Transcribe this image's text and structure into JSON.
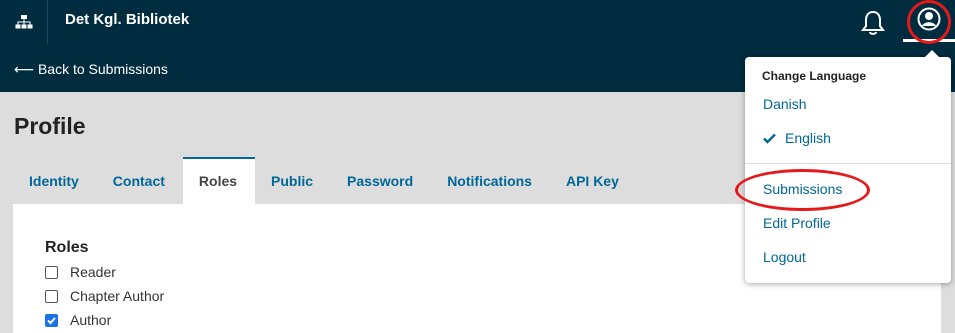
{
  "header": {
    "site_name": "Det Kgl. Bibliotek",
    "site_icon": "sitemap-icon",
    "notifications_icon": "bell-icon",
    "user_icon": "user-circle-icon"
  },
  "subheader": {
    "back_link": "⟵ Back to Submissions"
  },
  "main": {
    "title": "Profile",
    "tabs": [
      {
        "label": "Identity"
      },
      {
        "label": "Contact"
      },
      {
        "label": "Roles"
      },
      {
        "label": "Public"
      },
      {
        "label": "Password"
      },
      {
        "label": "Notifications"
      },
      {
        "label": "API Key"
      }
    ],
    "active_tab": "Roles",
    "roles_title": "Roles",
    "roles": [
      {
        "label": "Reader",
        "checked": false
      },
      {
        "label": "Chapter Author",
        "checked": false
      },
      {
        "label": "Author",
        "checked": true
      }
    ]
  },
  "user_menu": {
    "language_heading": "Change Language",
    "languages": [
      {
        "label": "Danish",
        "selected": false
      },
      {
        "label": "English",
        "selected": true
      }
    ],
    "items": [
      {
        "label": "Submissions"
      },
      {
        "label": "Edit Profile"
      },
      {
        "label": "Logout"
      }
    ]
  },
  "colors": {
    "header_bg": "#002c40",
    "link": "#006798",
    "annotation": "#e51919"
  }
}
